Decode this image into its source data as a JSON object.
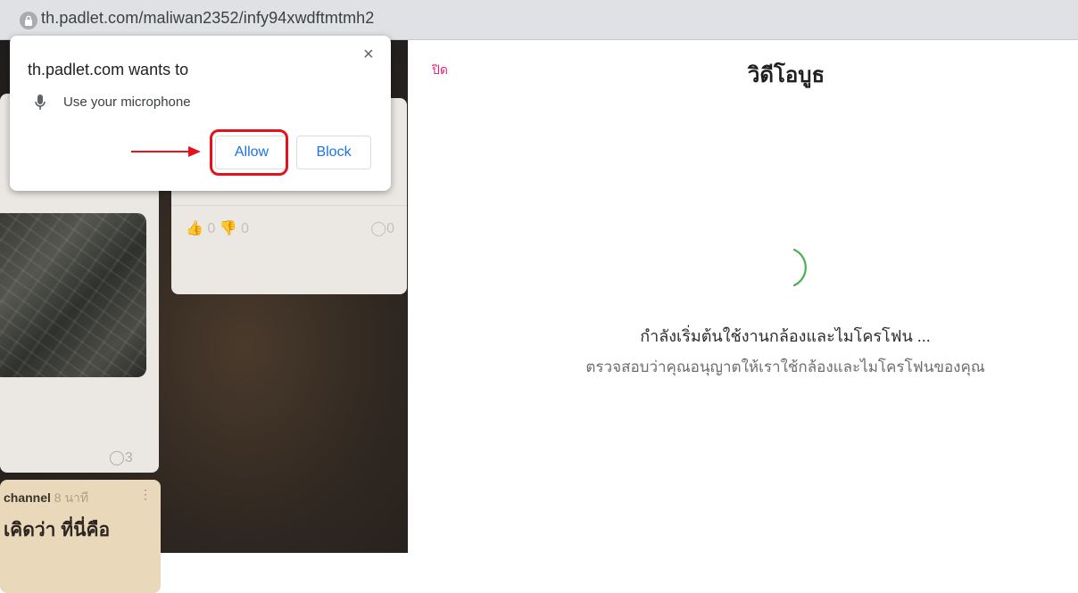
{
  "browser": {
    "url": "th.padlet.com/maliwan2352/infy94xwdftmtmh2"
  },
  "permission_popup": {
    "title": "th.padlet.com wants to",
    "permission": "Use your microphone",
    "allow_label": "Allow",
    "block_label": "Block",
    "close_glyph": "×"
  },
  "padlet_bg": {
    "card1_comment_count": "3",
    "card2_like_count": "0",
    "card2_dislike_count": "0",
    "card2_comment_count": "0",
    "card3_author": "channel",
    "card3_time": "8 นาที",
    "card3_text": "เคิดว่า ที่นี่คือ"
  },
  "video_booth": {
    "close_label": "ปิด",
    "title": "วิดีโอบูธ",
    "status": "กำลังเริ่มต้นใช้งานกล้องและไมโครโฟน ...",
    "hint": "ตรวจสอบว่าคุณอนุญาตให้เราใช้กล้องและไมโครโฟนของคุณ"
  },
  "colors": {
    "accent_blue": "#1a73e8",
    "highlight_red": "#e3121b",
    "close_pink": "#e4247a",
    "spinner_green": "#4caf50"
  },
  "icons": [
    "lock-icon",
    "microphone-icon",
    "close-icon",
    "spinner-icon",
    "thumbs-up-icon",
    "thumbs-down-icon",
    "comment-icon",
    "more-icon",
    "red-arrow-icon"
  ]
}
